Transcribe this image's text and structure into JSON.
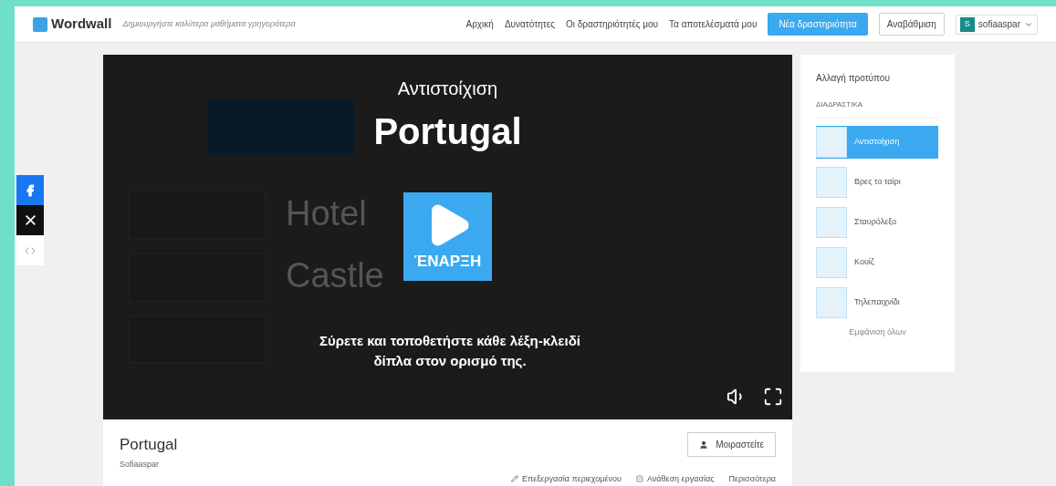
{
  "header": {
    "logo": "Wordwall",
    "tagline": "Δημιουργήστε καλύτερα μαθήματα γρηγορότερα",
    "nav": [
      "Αρχική",
      "Δυνατότητες",
      "Οι δραστηριότητές μου",
      "Τα αποτελέσματά μου"
    ],
    "new_button": "Νέα δραστηριότητα",
    "upgrade_button": "Αναβάθμιση",
    "user": {
      "initial": "S",
      "name": "sofiaaspar"
    }
  },
  "game": {
    "template": "Αντιστοίχιση",
    "title": "Portugal",
    "background_words": [
      "Hotel",
      "Castle"
    ],
    "start_label": "ΈΝΑΡΞΗ",
    "instructions": "Σύρετε και τοποθετήστε κάθε λέξη-κλειδί δίπλα στον ορισμό της."
  },
  "templates": {
    "title": "Αλλαγή προτύπου",
    "section": "ΔΙΑΔΡΑΣΤΙΚΑ",
    "items": [
      {
        "label": "Αντιστοίχιση",
        "selected": true
      },
      {
        "label": "Βρες το ταίρι",
        "selected": false
      },
      {
        "label": "Σταυρόλεξο",
        "selected": false
      },
      {
        "label": "Κουίζ",
        "selected": false
      },
      {
        "label": "Τηλεπαιχνίδι",
        "selected": false
      }
    ],
    "show_all": "Εμφάνιση όλων"
  },
  "info": {
    "title": "Portugal",
    "author": "Sofiaaspar",
    "share_button": "Μοιραστείτε",
    "actions": [
      "Επεξεργασία περιεχομένου",
      "Ανάθεση εργασίας",
      "Περισσότερα"
    ]
  }
}
